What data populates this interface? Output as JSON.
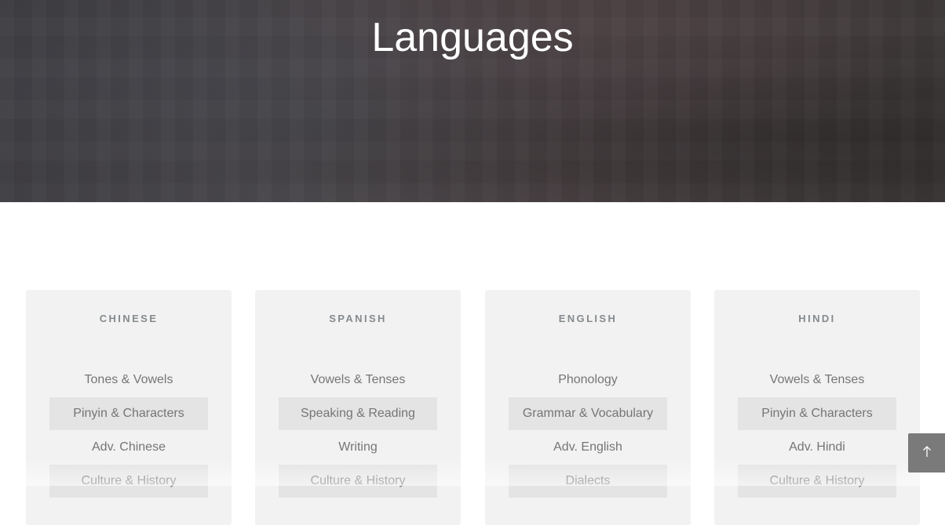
{
  "hero": {
    "title": "Languages"
  },
  "cards": [
    {
      "title": "CHINESE",
      "topics": [
        "Tones & Vowels",
        "Pinyin & Characters",
        "Adv. Chinese",
        "Culture & History"
      ]
    },
    {
      "title": "SPANISH",
      "topics": [
        "Vowels & Tenses",
        "Speaking & Reading",
        "Writing",
        "Culture & History"
      ]
    },
    {
      "title": "ENGLISH",
      "topics": [
        "Phonology",
        "Grammar & Vocabulary",
        "Adv. English",
        "Dialects"
      ]
    },
    {
      "title": "HINDI",
      "topics": [
        "Vowels & Tenses",
        "Pinyin & Characters",
        "Adv. Hindi",
        "Culture & History"
      ]
    }
  ],
  "back_to_top": {
    "icon": "arrow-up-icon"
  },
  "colors": {
    "hero_bg": "#444245",
    "card_bg": "#f2f2f2",
    "shaded_row": "#e4e4e4",
    "card_title": "#858a8e",
    "topic_text": "#757575",
    "back_to_top_bg": "#7a7a7a"
  }
}
